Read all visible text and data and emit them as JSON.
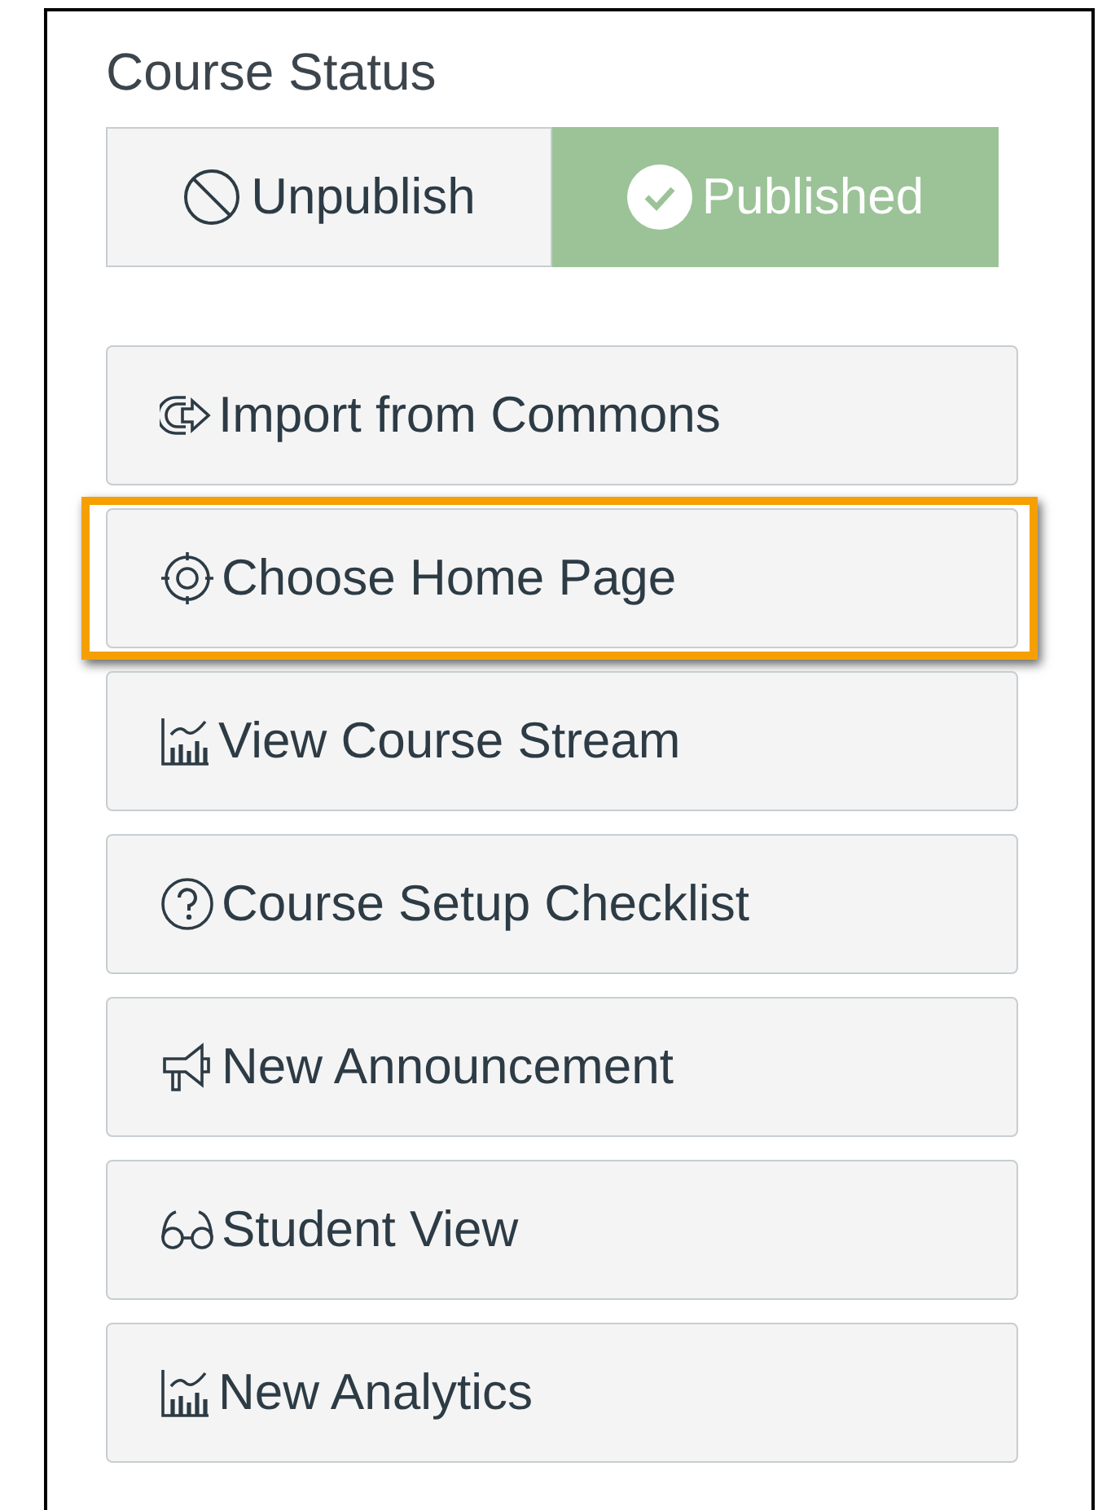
{
  "title": "Course Status",
  "status_toggle": [
    {
      "kind": "unpublish",
      "label": "Unpublish",
      "selected": false
    },
    {
      "kind": "published",
      "label": "Published",
      "selected": true
    }
  ],
  "actions": [
    {
      "kind": "import",
      "label": "Import from Commons",
      "highlighted": false
    },
    {
      "kind": "home-page",
      "label": "Choose Home Page",
      "highlighted": true
    },
    {
      "kind": "stream",
      "label": "View Course Stream",
      "highlighted": false
    },
    {
      "kind": "checklist",
      "label": "Course Setup Checklist",
      "highlighted": false
    },
    {
      "kind": "announcement",
      "label": "New Announcement",
      "highlighted": false
    },
    {
      "kind": "student-view",
      "label": "Student View",
      "highlighted": false
    },
    {
      "kind": "analytics",
      "label": "New Analytics",
      "highlighted": false
    }
  ]
}
